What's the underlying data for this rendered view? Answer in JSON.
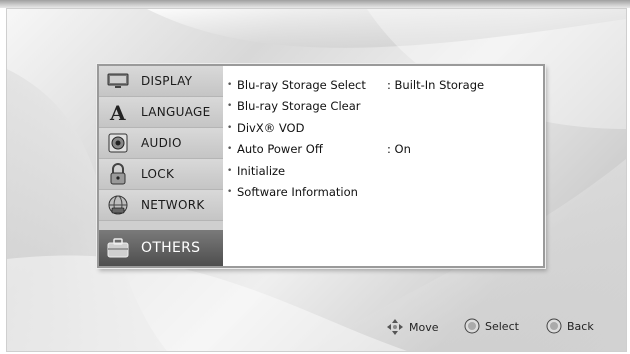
{
  "sidebar": {
    "items": [
      {
        "label": "DISPLAY",
        "icon": "display-icon"
      },
      {
        "label": "LANGUAGE",
        "icon": "language-icon"
      },
      {
        "label": "AUDIO",
        "icon": "audio-icon"
      },
      {
        "label": "LOCK",
        "icon": "lock-icon"
      },
      {
        "label": "NETWORK",
        "icon": "network-icon"
      },
      {
        "label": "OTHERS",
        "icon": "others-icon"
      }
    ],
    "selected": "OTHERS"
  },
  "main": {
    "items": [
      {
        "label": "Blu-ray Storage Select",
        "value": ": Built-In Storage"
      },
      {
        "label": "Blu-ray Storage Clear",
        "value": ""
      },
      {
        "label": "DivX® VOD",
        "value": ""
      },
      {
        "label": "Auto Power Off",
        "value": ": On"
      },
      {
        "label": "Initialize",
        "value": ""
      },
      {
        "label": "Software Information",
        "value": ""
      }
    ]
  },
  "footer": {
    "move_label": "Move",
    "select_label": "Select",
    "back_label": "Back"
  },
  "colors": {
    "selected_bg": "#5a5a5a",
    "sidebar_bg": "#cfcfcf",
    "panel_border": "#9a9a9a"
  }
}
